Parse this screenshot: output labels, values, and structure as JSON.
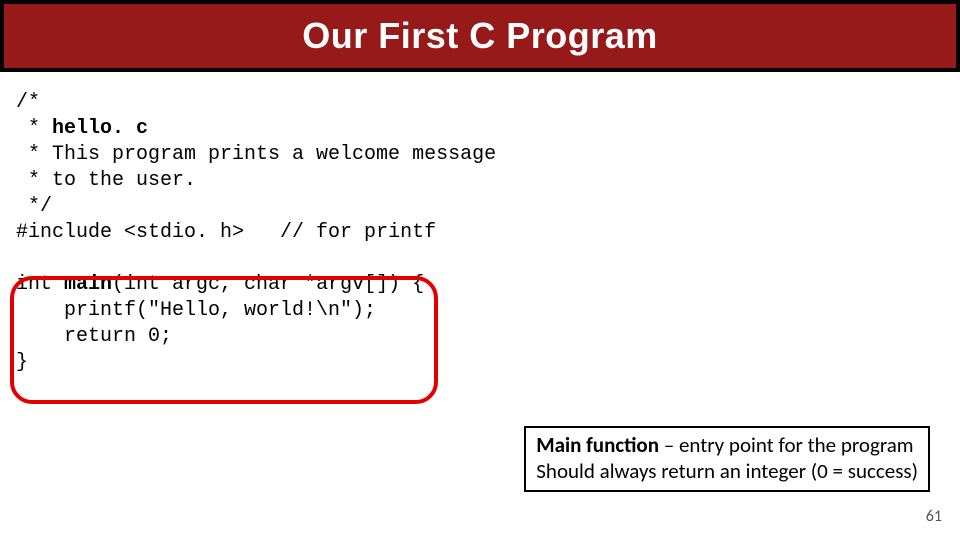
{
  "banner": {
    "title": "Our First C Program"
  },
  "code": {
    "l1": "/*",
    "l2a": " * ",
    "l2b": "hello. c",
    "l3": " * This program prints a welcome message",
    "l4": " * to the user.",
    "l5": " */",
    "l6a": "#include <stdio. h>   ",
    "l6b": "// for printf",
    "l7": "",
    "l8a": "int ",
    "l8b": "main",
    "l8c": "(int argc, char *argv[]) {",
    "l9": "    printf(\"Hello, world!\\n\");",
    "l10": "    return 0;",
    "l11": "}"
  },
  "callout": {
    "line1_bold": "Main function",
    "line1_rest": " – entry point for the program",
    "line2": "Should always return an integer (0 = success)"
  },
  "pagenum": "61"
}
